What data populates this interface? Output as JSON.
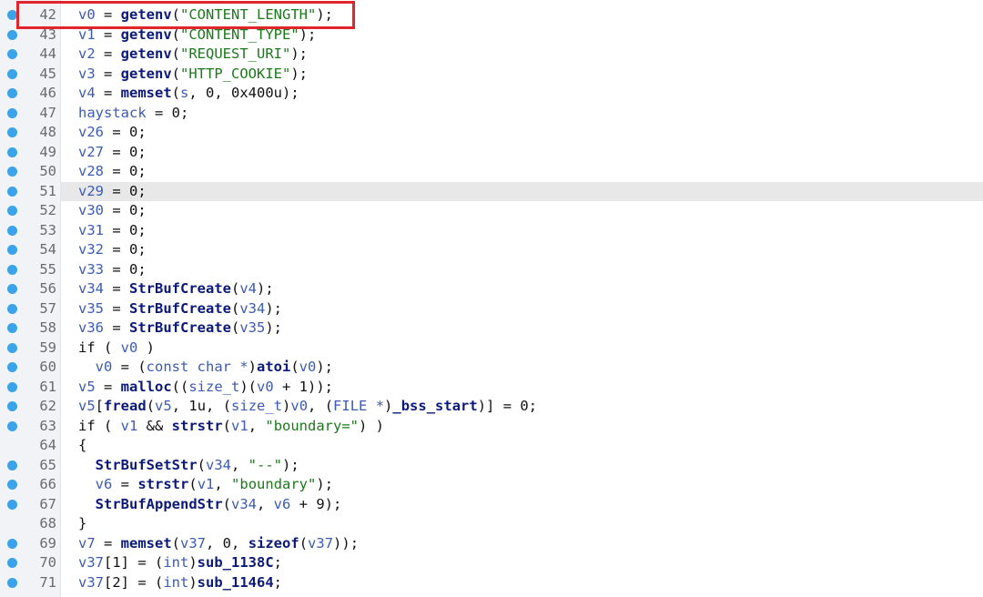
{
  "colors": {
    "breakpoint": "#3aa3ea",
    "highlight": "#e8e8e8",
    "box": "#e0262b",
    "string": "#1a7a1a",
    "variable": "#3b5bb5"
  },
  "lines": [
    {
      "num": "42",
      "bp": true,
      "code": [
        [
          "v",
          "v0"
        ],
        [
          "n",
          " = "
        ],
        [
          "f",
          "getenv"
        ],
        [
          "n",
          "("
        ],
        [
          "s",
          "\"CONTENT_LENGTH\""
        ],
        [
          "n",
          ");"
        ]
      ]
    },
    {
      "num": "43",
      "bp": true,
      "code": [
        [
          "v",
          "v1"
        ],
        [
          "n",
          " = "
        ],
        [
          "f",
          "getenv"
        ],
        [
          "n",
          "("
        ],
        [
          "s",
          "\"CONTENT_TYPE\""
        ],
        [
          "n",
          ");"
        ]
      ]
    },
    {
      "num": "44",
      "bp": true,
      "code": [
        [
          "v",
          "v2"
        ],
        [
          "n",
          " = "
        ],
        [
          "f",
          "getenv"
        ],
        [
          "n",
          "("
        ],
        [
          "s",
          "\"REQUEST_URI\""
        ],
        [
          "n",
          ");"
        ]
      ]
    },
    {
      "num": "45",
      "bp": true,
      "code": [
        [
          "v",
          "v3"
        ],
        [
          "n",
          " = "
        ],
        [
          "f",
          "getenv"
        ],
        [
          "n",
          "("
        ],
        [
          "s",
          "\"HTTP_COOKIE\""
        ],
        [
          "n",
          ");"
        ]
      ]
    },
    {
      "num": "46",
      "bp": true,
      "code": [
        [
          "v",
          "v4"
        ],
        [
          "n",
          " = "
        ],
        [
          "f",
          "memset"
        ],
        [
          "n",
          "("
        ],
        [
          "v",
          "s"
        ],
        [
          "n",
          ", 0, 0x400u);"
        ]
      ]
    },
    {
      "num": "47",
      "bp": true,
      "code": [
        [
          "v",
          "haystack"
        ],
        [
          "n",
          " = 0;"
        ]
      ]
    },
    {
      "num": "48",
      "bp": true,
      "code": [
        [
          "v",
          "v26"
        ],
        [
          "n",
          " = 0;"
        ]
      ]
    },
    {
      "num": "49",
      "bp": true,
      "code": [
        [
          "v",
          "v27"
        ],
        [
          "n",
          " = 0;"
        ]
      ]
    },
    {
      "num": "50",
      "bp": true,
      "code": [
        [
          "v",
          "v28"
        ],
        [
          "n",
          " = 0;"
        ]
      ]
    },
    {
      "num": "51",
      "bp": true,
      "hl": true,
      "code": [
        [
          "v",
          "v29"
        ],
        [
          "n",
          " = 0;"
        ]
      ]
    },
    {
      "num": "52",
      "bp": true,
      "code": [
        [
          "v",
          "v30"
        ],
        [
          "n",
          " = 0;"
        ]
      ]
    },
    {
      "num": "53",
      "bp": true,
      "code": [
        [
          "v",
          "v31"
        ],
        [
          "n",
          " = 0;"
        ]
      ]
    },
    {
      "num": "54",
      "bp": true,
      "code": [
        [
          "v",
          "v32"
        ],
        [
          "n",
          " = 0;"
        ]
      ]
    },
    {
      "num": "55",
      "bp": true,
      "code": [
        [
          "v",
          "v33"
        ],
        [
          "n",
          " = 0;"
        ]
      ]
    },
    {
      "num": "56",
      "bp": true,
      "code": [
        [
          "v",
          "v34"
        ],
        [
          "n",
          " = "
        ],
        [
          "f",
          "StrBufCreate"
        ],
        [
          "n",
          "("
        ],
        [
          "v",
          "v4"
        ],
        [
          "n",
          ");"
        ]
      ]
    },
    {
      "num": "57",
      "bp": true,
      "code": [
        [
          "v",
          "v35"
        ],
        [
          "n",
          " = "
        ],
        [
          "f",
          "StrBufCreate"
        ],
        [
          "n",
          "("
        ],
        [
          "v",
          "v34"
        ],
        [
          "n",
          ");"
        ]
      ]
    },
    {
      "num": "58",
      "bp": true,
      "code": [
        [
          "v",
          "v36"
        ],
        [
          "n",
          " = "
        ],
        [
          "f",
          "StrBufCreate"
        ],
        [
          "n",
          "("
        ],
        [
          "v",
          "v35"
        ],
        [
          "n",
          ");"
        ]
      ]
    },
    {
      "num": "59",
      "bp": true,
      "code": [
        [
          "n",
          "if ( "
        ],
        [
          "v",
          "v0"
        ],
        [
          "n",
          " )"
        ]
      ]
    },
    {
      "num": "60",
      "bp": true,
      "code": [
        [
          "n",
          "  "
        ],
        [
          "v",
          "v0"
        ],
        [
          "n",
          " = ("
        ],
        [
          "t",
          "const char *"
        ],
        [
          "n",
          ")"
        ],
        [
          "f",
          "atoi"
        ],
        [
          "n",
          "("
        ],
        [
          "v",
          "v0"
        ],
        [
          "n",
          ");"
        ]
      ]
    },
    {
      "num": "61",
      "bp": true,
      "code": [
        [
          "v",
          "v5"
        ],
        [
          "n",
          " = "
        ],
        [
          "f",
          "malloc"
        ],
        [
          "n",
          "(("
        ],
        [
          "t",
          "size_t"
        ],
        [
          "n",
          ")("
        ],
        [
          "v",
          "v0"
        ],
        [
          "n",
          " + 1));"
        ]
      ]
    },
    {
      "num": "62",
      "bp": true,
      "code": [
        [
          "v",
          "v5"
        ],
        [
          "n",
          "["
        ],
        [
          "f",
          "fread"
        ],
        [
          "n",
          "("
        ],
        [
          "v",
          "v5"
        ],
        [
          "n",
          ", 1u, ("
        ],
        [
          "t",
          "size_t"
        ],
        [
          "n",
          ")"
        ],
        [
          "v",
          "v0"
        ],
        [
          "n",
          ", ("
        ],
        [
          "t",
          "FILE *"
        ],
        [
          "n",
          ")"
        ],
        [
          "f",
          "_bss_start"
        ],
        [
          "n",
          ")] = 0;"
        ]
      ]
    },
    {
      "num": "63",
      "bp": true,
      "code": [
        [
          "n",
          "if ( "
        ],
        [
          "v",
          "v1"
        ],
        [
          "n",
          " && "
        ],
        [
          "f",
          "strstr"
        ],
        [
          "n",
          "("
        ],
        [
          "v",
          "v1"
        ],
        [
          "n",
          ", "
        ],
        [
          "s",
          "\"boundary=\""
        ],
        [
          "n",
          ") )"
        ]
      ]
    },
    {
      "num": "64",
      "bp": false,
      "code": [
        [
          "n",
          "{"
        ]
      ]
    },
    {
      "num": "65",
      "bp": true,
      "code": [
        [
          "n",
          "  "
        ],
        [
          "f",
          "StrBufSetStr"
        ],
        [
          "n",
          "("
        ],
        [
          "v",
          "v34"
        ],
        [
          "n",
          ", "
        ],
        [
          "s",
          "\"--\""
        ],
        [
          "n",
          ");"
        ]
      ]
    },
    {
      "num": "66",
      "bp": true,
      "code": [
        [
          "n",
          "  "
        ],
        [
          "v",
          "v6"
        ],
        [
          "n",
          " = "
        ],
        [
          "f",
          "strstr"
        ],
        [
          "n",
          "("
        ],
        [
          "v",
          "v1"
        ],
        [
          "n",
          ", "
        ],
        [
          "s",
          "\"boundary\""
        ],
        [
          "n",
          ");"
        ]
      ]
    },
    {
      "num": "67",
      "bp": true,
      "code": [
        [
          "n",
          "  "
        ],
        [
          "f",
          "StrBufAppendStr"
        ],
        [
          "n",
          "("
        ],
        [
          "v",
          "v34"
        ],
        [
          "n",
          ", "
        ],
        [
          "v",
          "v6"
        ],
        [
          "n",
          " + 9);"
        ]
      ]
    },
    {
      "num": "68",
      "bp": false,
      "code": [
        [
          "n",
          "}"
        ]
      ]
    },
    {
      "num": "69",
      "bp": true,
      "code": [
        [
          "v",
          "v7"
        ],
        [
          "n",
          " = "
        ],
        [
          "f",
          "memset"
        ],
        [
          "n",
          "("
        ],
        [
          "v",
          "v37"
        ],
        [
          "n",
          ", 0, "
        ],
        [
          "f",
          "sizeof"
        ],
        [
          "n",
          "("
        ],
        [
          "v",
          "v37"
        ],
        [
          "n",
          "));"
        ]
      ]
    },
    {
      "num": "70",
      "bp": true,
      "code": [
        [
          "v",
          "v37"
        ],
        [
          "n",
          "[1] = ("
        ],
        [
          "t",
          "int"
        ],
        [
          "n",
          ")"
        ],
        [
          "f",
          "sub_1138C"
        ],
        [
          "n",
          ";"
        ]
      ]
    },
    {
      "num": "71",
      "bp": true,
      "code": [
        [
          "v",
          "v37"
        ],
        [
          "n",
          "[2] = ("
        ],
        [
          "t",
          "int"
        ],
        [
          "n",
          ")"
        ],
        [
          "f",
          "sub_11464"
        ],
        [
          "n",
          ";"
        ]
      ]
    }
  ]
}
